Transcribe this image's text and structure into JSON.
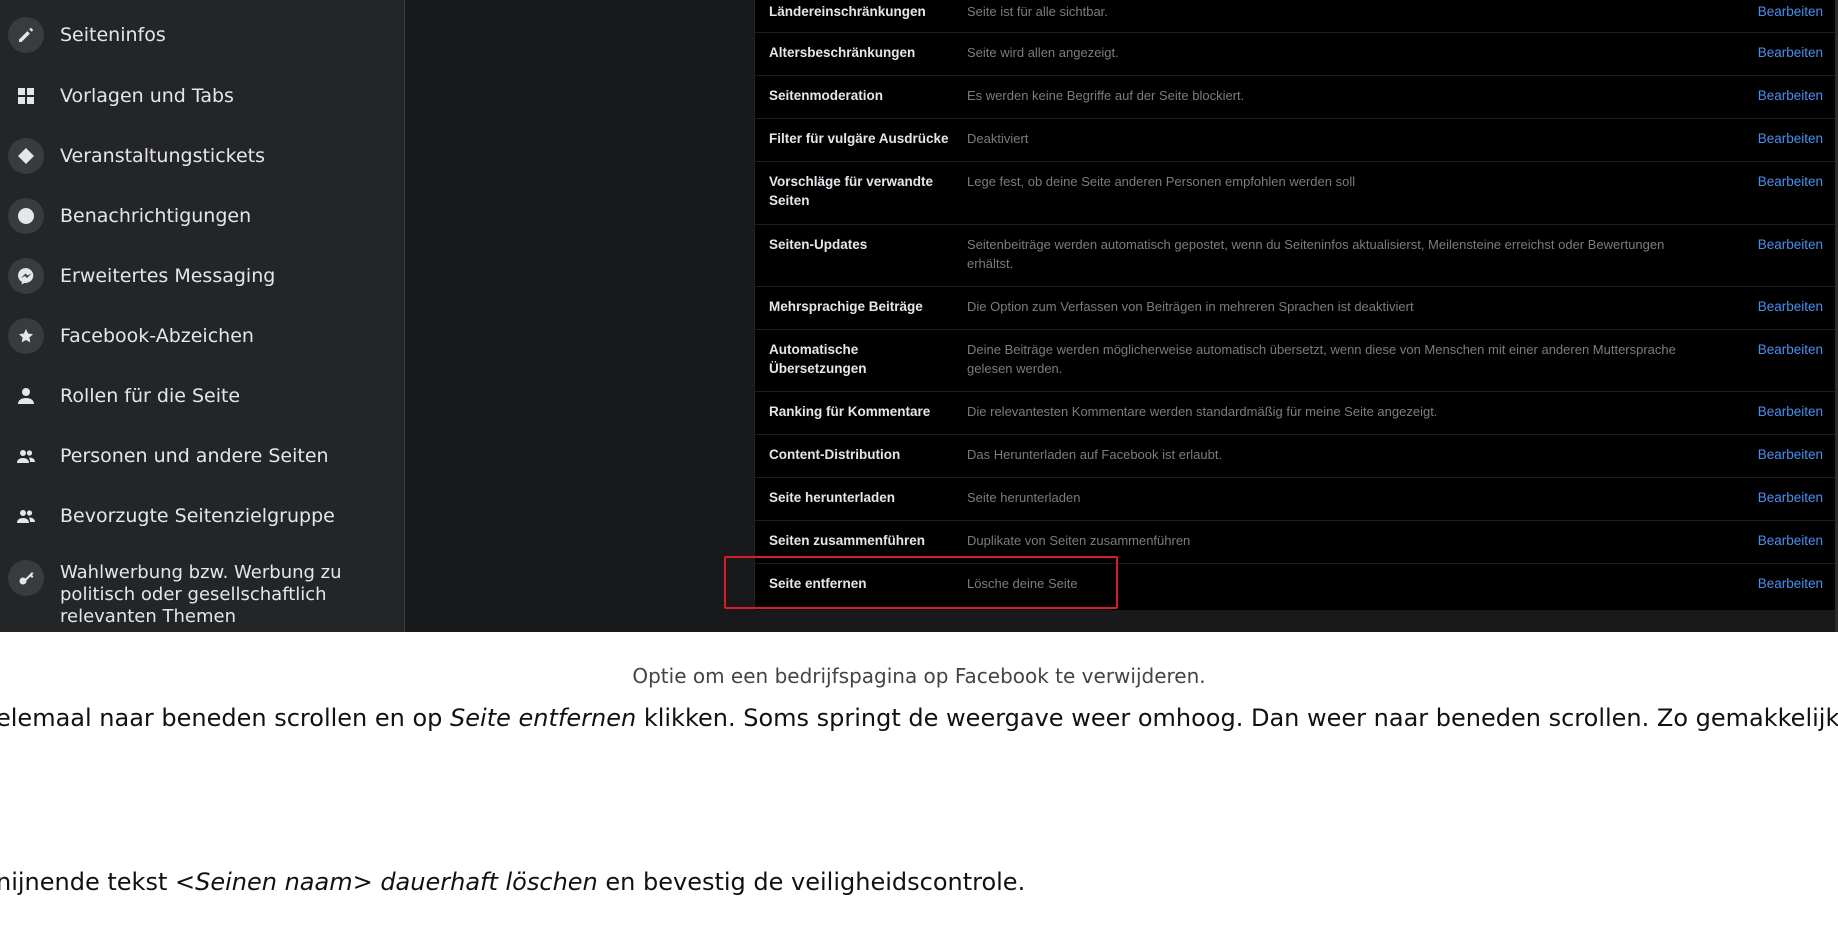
{
  "sidebar": {
    "items": [
      {
        "label": "Seiteninfos",
        "icon": "pencil-icon"
      },
      {
        "label": "Vorlagen und Tabs",
        "icon": "grid-icon"
      },
      {
        "label": "Veranstaltungstickets",
        "icon": "ticket-icon"
      },
      {
        "label": "Benachrichtigungen",
        "icon": "globe-icon"
      },
      {
        "label": "Erweitertes Messaging",
        "icon": "messenger-icon"
      },
      {
        "label": "Facebook-Abzeichen",
        "icon": "star-badge-icon"
      },
      {
        "label": "Rollen für die Seite",
        "icon": "person-icon"
      },
      {
        "label": "Personen und andere Seiten",
        "icon": "people-icon"
      },
      {
        "label": "Bevorzugte Seitenzielgruppe",
        "icon": "people-icon"
      },
      {
        "label": "Wahlwerbung bzw. Werbung zu politisch oder gesellschaftlich relevanten Themen",
        "icon": "key-icon"
      }
    ]
  },
  "settings": {
    "edit_label": "Bearbeiten",
    "rows": [
      {
        "label": "Ländereinschränkungen",
        "value": "Seite ist für alle sichtbar."
      },
      {
        "label": "Altersbeschränkungen",
        "value": "Seite wird allen angezeigt."
      },
      {
        "label": "Seitenmoderation",
        "value": "Es werden keine Begriffe auf der Seite blockiert."
      },
      {
        "label": "Filter für vulgäre Ausdrücke",
        "value": "Deaktiviert"
      },
      {
        "label": "Vorschläge für verwandte Seiten",
        "value": "Lege fest, ob deine Seite anderen Personen empfohlen werden soll"
      },
      {
        "label": "Seiten-Updates",
        "value": "Seitenbeiträge werden automatisch gepostet, wenn du Seiteninfos aktualisierst, Meilensteine erreichst oder Bewertungen erhältst."
      },
      {
        "label": "Mehrsprachige Beiträge",
        "value": "Die Option zum Verfassen von Beiträgen in mehreren Sprachen ist deaktiviert"
      },
      {
        "label": "Automatische Übersetzungen",
        "value": "Deine Beiträge werden möglicherweise automatisch übersetzt, wenn diese von Menschen mit einer anderen Muttersprache gelesen werden."
      },
      {
        "label": "Ranking für Kommentare",
        "value": "Die relevantesten Kommentare werden standardmäßig für meine Seite angezeigt."
      },
      {
        "label": "Content-Distribution",
        "value": "Das Herunterladen auf Facebook ist erlaubt."
      },
      {
        "label": "Seite herunterladen",
        "value": "Seite herunterladen"
      },
      {
        "label": "Seiten zusammenführen",
        "value": "Duplikate von Seiten zusammenführen"
      },
      {
        "label": "Seite entfernen",
        "value": "Lösche deine Seite"
      }
    ]
  },
  "article": {
    "caption": "Optie om een bedrijfspagina op Facebook te verwijderen.",
    "p1_before": "elemaal naar beneden scrollen en op ",
    "p1_em": "Seite entfernen",
    "p1_after": " klikken. Soms springt de weergave weer omhoog. Dan weer naar beneden scrollen. Zo gemakkelijk l",
    "p2_before": "nijnende tekst ",
    "p2_em": "<Seinen naam> dauerhaft löschen",
    "p2_after": " en bevestig de veiligheidscontrole."
  },
  "colors": {
    "highlight": "#d91c2b",
    "link": "#4a8ff0"
  }
}
